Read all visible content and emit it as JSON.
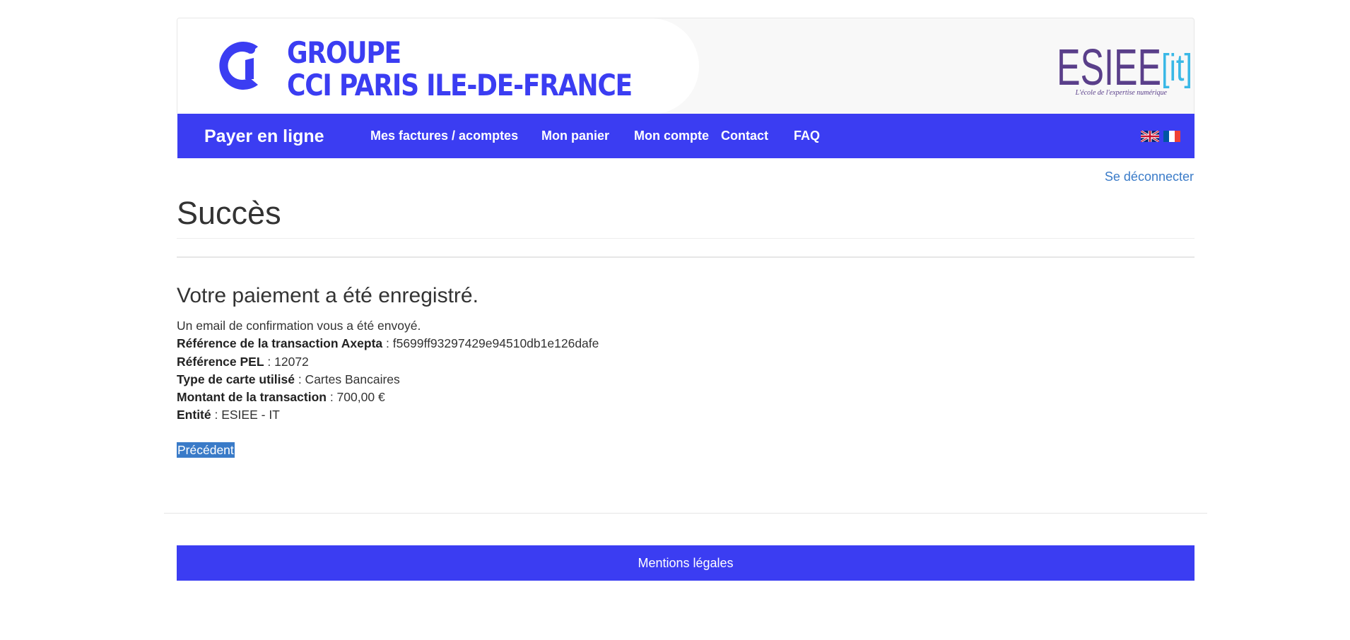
{
  "header": {
    "cci_line1": "GROUPE",
    "cci_line2": "CCI PARIS ILE-DE-FRANCE",
    "esiee_logo_text": "ESIEE",
    "esiee_logo_suffix": "[it]",
    "esiee_tagline": "L'école de l'expertise numérique",
    "colors": {
      "brand_blue": "#3b3df2",
      "esiee_purple": "#5a3f8a",
      "esiee_cyan": "#3ab8e6"
    }
  },
  "navbar": {
    "brand": "Payer en ligne",
    "items": [
      {
        "label": "Mes factures / acomptes"
      },
      {
        "label": "Mon panier"
      },
      {
        "label": "Mon compte"
      },
      {
        "label": "Contact"
      },
      {
        "label": "FAQ"
      }
    ],
    "languages": [
      "english-flag-icon",
      "french-flag-icon"
    ]
  },
  "logout": "Se déconnecter",
  "page": {
    "title": "Succès",
    "heading": "Votre paiement a été enregistré.",
    "confirmation": "Un email de confirmation vous a été envoyé.",
    "details": [
      {
        "label": "Référence de la transaction Axepta",
        "value": " : f5699ff93297429e94510db1e126dafe"
      },
      {
        "label": "Référence PEL",
        "value": " : 12072"
      },
      {
        "label": "Type de carte utilisé",
        "value": " : Cartes Bancaires"
      },
      {
        "label": "Montant de la transaction",
        "value": " : 700,00 €"
      },
      {
        "label": "Entité",
        "value": " : ESIEE - IT"
      }
    ],
    "prev_link": "Précédent"
  },
  "footer": {
    "legal": "Mentions légales"
  }
}
